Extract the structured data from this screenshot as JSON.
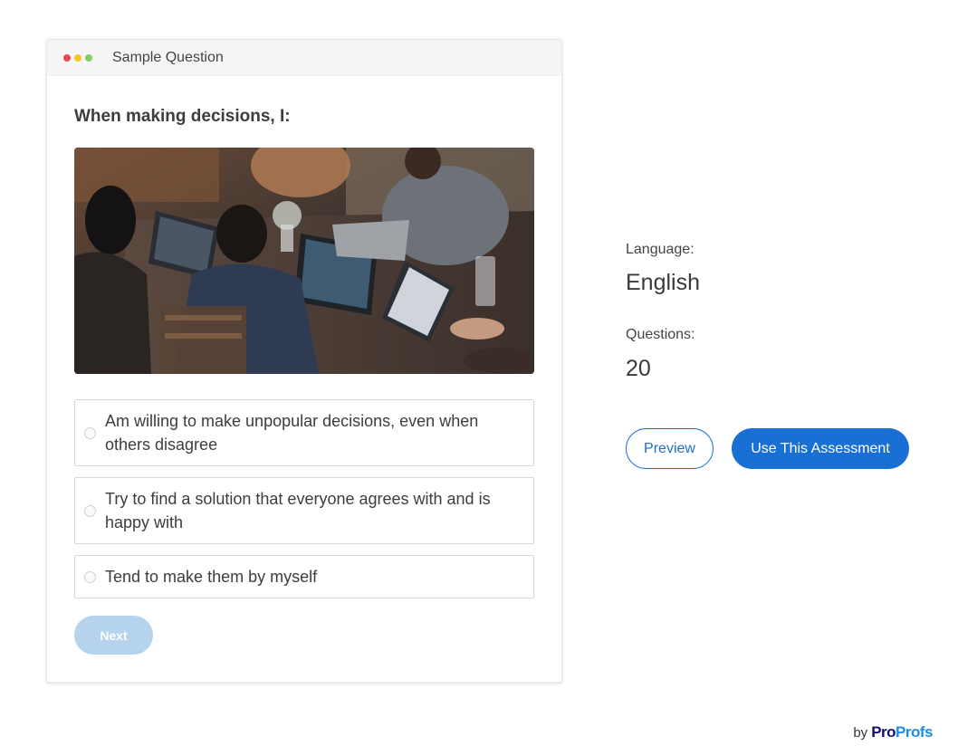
{
  "card": {
    "title": "Sample Question",
    "window_dots": [
      "#ee4b4b",
      "#f7c52b",
      "#7fd35e"
    ]
  },
  "question": {
    "text": "When making decisions, I:",
    "options": [
      "Am willing to make unpopular decisions, even when others disagree",
      "Try to find a solution that everyone agrees with and is happy with",
      "Tend to make them by myself"
    ],
    "next_label": "Next"
  },
  "meta": {
    "language_label": "Language:",
    "language_value": "English",
    "questions_label": "Questions:",
    "questions_value": "20"
  },
  "actions": {
    "preview_label": "Preview",
    "use_label": "Use This Assessment"
  },
  "branding": {
    "by": "by",
    "logo_part1": "Pro",
    "logo_part2": "Profs"
  },
  "colors": {
    "accent": "#1a6fd4",
    "next_disabled": "#b6d3ee",
    "logo_dark": "#13106b",
    "logo_light": "#1a8fe8"
  }
}
